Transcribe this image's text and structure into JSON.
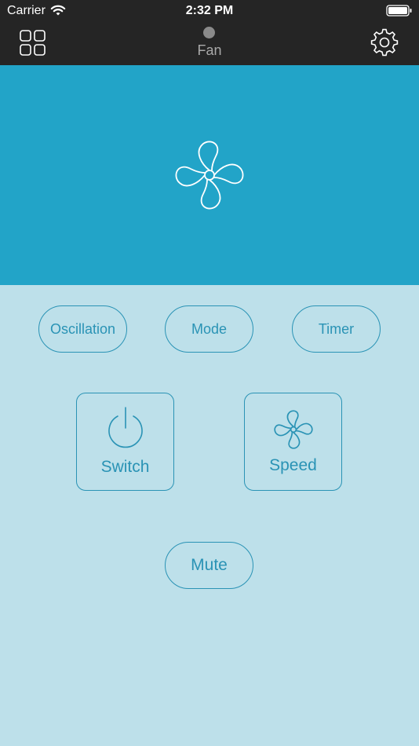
{
  "status_bar": {
    "carrier": "Carrier",
    "time": "2:32 PM"
  },
  "nav": {
    "title": "Fan",
    "left_icon": "grid-icon",
    "right_icon": "gear-icon",
    "status_dot_color": "#8a8a8a"
  },
  "hero": {
    "icon": "fan-icon",
    "background": "#22a4c8"
  },
  "controls": {
    "oscillation_label": "Oscillation",
    "mode_label": "Mode",
    "timer_label": "Timer",
    "switch_label": "Switch",
    "speed_label": "Speed",
    "mute_label": "Mute",
    "accent": "#2a93b5"
  }
}
